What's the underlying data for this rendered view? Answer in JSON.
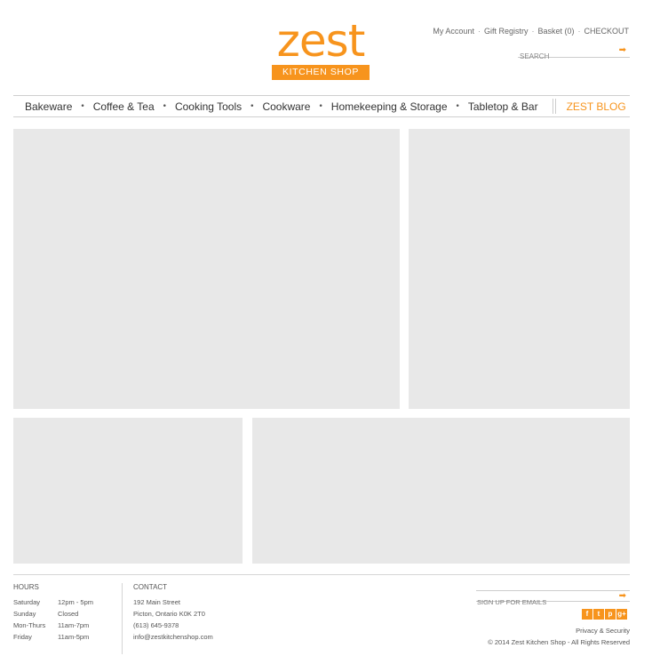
{
  "header": {
    "logo_word": "zest",
    "logo_tagline": "KITCHEN SHOP",
    "utility_links": [
      "My Account",
      "Gift Registry",
      "Basket (0)",
      "CHECKOUT"
    ],
    "search": {
      "placeholder": "SEARCH",
      "button_icon": "arrow-right-icon"
    }
  },
  "nav": {
    "items": [
      "Bakeware",
      "Coffee & Tea",
      "Cooking Tools",
      "Cookware",
      "Homekeeping & Storage",
      "Tabletop & Bar"
    ],
    "blog": "ZEST BLOG"
  },
  "footer": {
    "hours": {
      "heading": "HOURS",
      "rows": [
        {
          "day": "Saturday",
          "time": "12pm - 5pm"
        },
        {
          "day": "Sunday",
          "time": "Closed"
        },
        {
          "day": "Mon-Thurs",
          "time": "11am-7pm"
        },
        {
          "day": "Friday",
          "time": "11am-5pm"
        }
      ]
    },
    "contact": {
      "heading": "CONTACT",
      "lines": [
        "192 Main Street",
        "Picton, Ontario K0K 2T0",
        "(613) 645-9378",
        "info@zestkitchenshop.com"
      ]
    },
    "signup": {
      "placeholder": "SIGN UP FOR EMAILS",
      "button_icon": "arrow-right-icon"
    },
    "social": [
      {
        "name": "facebook-icon",
        "glyph": "f"
      },
      {
        "name": "twitter-icon",
        "glyph": "t"
      },
      {
        "name": "pinterest-icon",
        "glyph": "p"
      },
      {
        "name": "googleplus-icon",
        "glyph": "g+"
      }
    ],
    "privacy": "Privacy & Security",
    "copyright": "© 2014 Zest Kitchen Shop - All Rights Reserved"
  },
  "colors": {
    "accent": "#f7941d",
    "panel": "#e8e8e8",
    "rule": "#cfcfcf"
  }
}
